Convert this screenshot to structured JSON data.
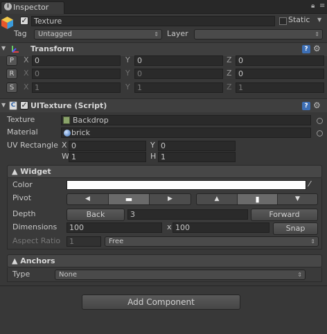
{
  "tab": {
    "label": "Inspector"
  },
  "header": {
    "object_name": "Texture",
    "static_label": "Static",
    "tag_label": "Tag",
    "tag_value": "Untagged",
    "layer_label": "Layer",
    "layer_value": ""
  },
  "transform": {
    "title": "Transform",
    "rows": [
      {
        "btn": "P",
        "x": "0",
        "y": "0",
        "z": "0"
      },
      {
        "btn": "R",
        "x": "0",
        "y": "0",
        "z": "0"
      },
      {
        "btn": "S",
        "x": "1",
        "y": "1",
        "z": "1"
      }
    ],
    "axis_x": "X",
    "axis_y": "Y",
    "axis_z": "Z"
  },
  "uitexture": {
    "title": "UITexture (Script)",
    "texture_label": "Texture",
    "texture_value": "Backdrop",
    "material_label": "Material",
    "material_value": "brick",
    "uvrect_label": "UV Rectangle",
    "uv_x_label": "X",
    "uv_x": "0",
    "uv_y_label": "Y",
    "uv_y": "0",
    "uv_w_label": "W",
    "uv_w": "1",
    "uv_h_label": "H",
    "uv_h": "1"
  },
  "widget": {
    "title": "▲ Widget",
    "color_label": "Color",
    "color_value": "#ffffff",
    "pivot_label": "Pivot",
    "depth_label": "Depth",
    "back_label": "Back",
    "depth_value": "3",
    "forward_label": "Forward",
    "dimensions_label": "Dimensions",
    "dim_w": "100",
    "dim_x": "x",
    "dim_h": "100",
    "snap_label": "Snap",
    "aspect_label": "Aspect Ratio",
    "aspect_value": "1",
    "aspect_mode": "Free"
  },
  "anchors": {
    "title": "▲ Anchors",
    "type_label": "Type",
    "type_value": "None"
  },
  "add_component_label": "Add Component"
}
